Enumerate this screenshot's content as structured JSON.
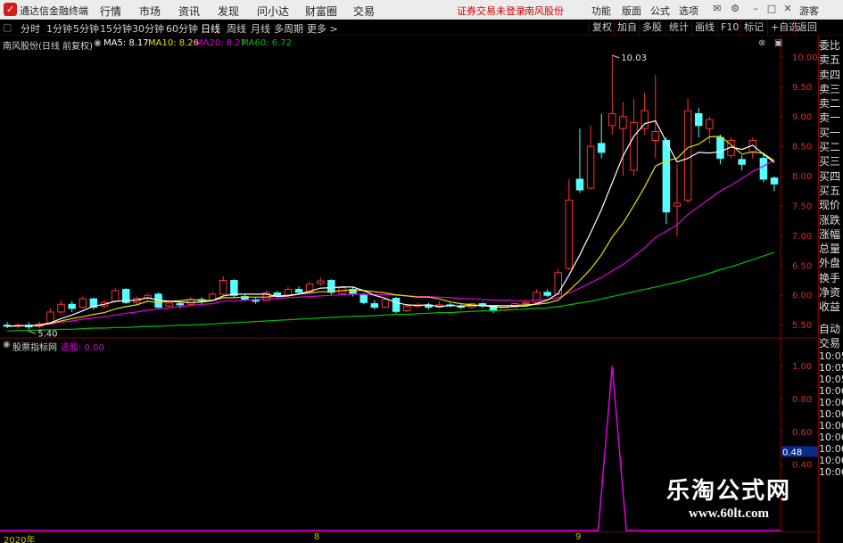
{
  "titlebar": {
    "app_name": "通达信金融终端",
    "menus": [
      "行情",
      "市场",
      "资讯",
      "发现",
      "问小达",
      "财富圈",
      "交易"
    ],
    "notice": "证券交易未登录",
    "stock_name": "南风股份",
    "right_menus": [
      "功能",
      "版面",
      "公式",
      "选项"
    ],
    "account": "游客"
  },
  "toolbar": {
    "periods": [
      "分时",
      "1分钟",
      "5分钟",
      "15分钟",
      "30分钟",
      "60分钟",
      "日线",
      "周线",
      "月线",
      "多周期",
      "更多 >"
    ],
    "active_period": "日线",
    "right_buttons": [
      "复权",
      "加自",
      "多股",
      "统计",
      "画线",
      "F10",
      "标记",
      "+自选",
      "返回"
    ]
  },
  "main_chart": {
    "title": "南风股份(日线 前复权)",
    "ma_legend": [
      {
        "label": "MA5: 8.17",
        "color": "#ffffff"
      },
      {
        "label": "MA10: 8.26",
        "color": "#e8e000"
      },
      {
        "label": "MA20: 8.27",
        "color": "#e000e0"
      },
      {
        "label": "MA60: 6.72",
        "color": "#00c000"
      }
    ],
    "y_ticks": [
      "10.00",
      "9.50",
      "9.00",
      "8.50",
      "8.00",
      "7.50",
      "7.00",
      "6.50",
      "6.00",
      "5.50"
    ],
    "high_label": "10.03",
    "low_label": "5.40",
    "up_color": "#ff3232",
    "down_color": "#54ffff"
  },
  "sub_chart": {
    "title": "股票指标网",
    "legend_label": "选股: 0.00",
    "legend_color": "#e000e0",
    "y_ticks": [
      "1.00",
      "0.80",
      "0.60",
      "0.40"
    ],
    "current_value": "0.48"
  },
  "right_panel": {
    "items": [
      "委比",
      "卖五",
      "卖四",
      "卖三",
      "卖二",
      "卖一",
      "买一",
      "买二",
      "买三",
      "买四",
      "买五",
      "现价",
      "涨跌",
      "涨幅",
      "总量",
      "外盘",
      "换手",
      "净资",
      "收益"
    ],
    "sub_items": [
      "自动",
      "交易"
    ],
    "times": [
      "10:05",
      "10:05",
      "10:05",
      "10:06",
      "10:06",
      "10:06",
      "10:06",
      "10:06",
      "10:06",
      "10:06",
      "10:06"
    ]
  },
  "bottom_axis": {
    "labels": [
      "2020年",
      "8",
      "9"
    ]
  },
  "watermark": {
    "line1": "乐淘公式网",
    "line2": "www.60lt.com"
  },
  "chart_data": {
    "type": "candlestick",
    "title": "南风股份(日线 前复权)",
    "ylim": [
      5.3,
      10.15
    ],
    "candles": [
      {
        "o": 5.5,
        "c": 5.48,
        "h": 5.55,
        "l": 5.45
      },
      {
        "o": 5.48,
        "c": 5.5,
        "h": 5.53,
        "l": 5.44
      },
      {
        "o": 5.5,
        "c": 5.47,
        "h": 5.55,
        "l": 5.4
      },
      {
        "o": 5.48,
        "c": 5.52,
        "h": 5.56,
        "l": 5.45
      },
      {
        "o": 5.52,
        "c": 5.72,
        "h": 5.78,
        "l": 5.5
      },
      {
        "o": 5.72,
        "c": 5.85,
        "h": 5.92,
        "l": 5.7
      },
      {
        "o": 5.85,
        "c": 5.78,
        "h": 5.9,
        "l": 5.72
      },
      {
        "o": 5.8,
        "c": 5.94,
        "h": 5.98,
        "l": 5.78
      },
      {
        "o": 5.94,
        "c": 5.8,
        "h": 5.96,
        "l": 5.76
      },
      {
        "o": 5.82,
        "c": 5.88,
        "h": 5.92,
        "l": 5.78
      },
      {
        "o": 5.9,
        "c": 6.08,
        "h": 6.12,
        "l": 5.88
      },
      {
        "o": 6.1,
        "c": 5.88,
        "h": 6.12,
        "l": 5.85
      },
      {
        "o": 5.88,
        "c": 5.95,
        "h": 5.98,
        "l": 5.85
      },
      {
        "o": 5.95,
        "c": 6.0,
        "h": 6.03,
        "l": 5.92
      },
      {
        "o": 6.02,
        "c": 5.8,
        "h": 6.05,
        "l": 5.78
      },
      {
        "o": 5.82,
        "c": 5.87,
        "h": 5.92,
        "l": 5.8
      },
      {
        "o": 5.86,
        "c": 5.84,
        "h": 5.9,
        "l": 5.78
      },
      {
        "o": 5.85,
        "c": 5.93,
        "h": 5.97,
        "l": 5.82
      },
      {
        "o": 5.93,
        "c": 5.91,
        "h": 5.97,
        "l": 5.86
      },
      {
        "o": 5.92,
        "c": 6.02,
        "h": 6.06,
        "l": 5.9
      },
      {
        "o": 6.02,
        "c": 6.25,
        "h": 6.32,
        "l": 6.0
      },
      {
        "o": 6.25,
        "c": 6.0,
        "h": 6.27,
        "l": 5.95
      },
      {
        "o": 5.98,
        "c": 5.93,
        "h": 6.02,
        "l": 5.9
      },
      {
        "o": 5.92,
        "c": 5.9,
        "h": 5.96,
        "l": 5.86
      },
      {
        "o": 5.91,
        "c": 6.04,
        "h": 6.08,
        "l": 5.89
      },
      {
        "o": 6.04,
        "c": 6.0,
        "h": 6.08,
        "l": 5.97
      },
      {
        "o": 6.0,
        "c": 6.1,
        "h": 6.14,
        "l": 5.98
      },
      {
        "o": 6.1,
        "c": 6.05,
        "h": 6.15,
        "l": 6.02
      },
      {
        "o": 6.06,
        "c": 6.19,
        "h": 6.22,
        "l": 6.04
      },
      {
        "o": 6.2,
        "c": 6.24,
        "h": 6.3,
        "l": 6.16
      },
      {
        "o": 6.25,
        "c": 6.05,
        "h": 6.27,
        "l": 6.0
      },
      {
        "o": 6.03,
        "c": 6.13,
        "h": 6.16,
        "l": 6.0
      },
      {
        "o": 6.1,
        "c": 6.02,
        "h": 6.14,
        "l": 5.98
      },
      {
        "o": 6.0,
        "c": 5.88,
        "h": 6.04,
        "l": 5.85
      },
      {
        "o": 5.86,
        "c": 5.8,
        "h": 5.92,
        "l": 5.76
      },
      {
        "o": 5.8,
        "c": 5.93,
        "h": 5.96,
        "l": 5.78
      },
      {
        "o": 5.95,
        "c": 5.73,
        "h": 5.97,
        "l": 5.7
      },
      {
        "o": 5.74,
        "c": 5.82,
        "h": 5.85,
        "l": 5.72
      },
      {
        "o": 5.82,
        "c": 5.84,
        "h": 5.88,
        "l": 5.78
      },
      {
        "o": 5.84,
        "c": 5.8,
        "h": 5.88,
        "l": 5.76
      },
      {
        "o": 5.8,
        "c": 5.84,
        "h": 5.9,
        "l": 5.78
      },
      {
        "o": 5.84,
        "c": 5.83,
        "h": 5.87,
        "l": 5.8
      },
      {
        "o": 5.82,
        "c": 5.8,
        "h": 5.85,
        "l": 5.77
      },
      {
        "o": 5.8,
        "c": 5.86,
        "h": 5.88,
        "l": 5.78
      },
      {
        "o": 5.86,
        "c": 5.82,
        "h": 5.88,
        "l": 5.79
      },
      {
        "o": 5.82,
        "c": 5.74,
        "h": 5.84,
        "l": 5.7
      },
      {
        "o": 5.75,
        "c": 5.8,
        "h": 5.83,
        "l": 5.73
      },
      {
        "o": 5.8,
        "c": 5.86,
        "h": 5.88,
        "l": 5.78
      },
      {
        "o": 5.86,
        "c": 5.88,
        "h": 5.92,
        "l": 5.84
      },
      {
        "o": 5.88,
        "c": 6.05,
        "h": 6.1,
        "l": 5.86
      },
      {
        "o": 6.05,
        "c": 6.0,
        "h": 6.1,
        "l": 5.97
      },
      {
        "o": 6.02,
        "c": 6.38,
        "h": 6.45,
        "l": 6.0
      },
      {
        "o": 6.45,
        "c": 7.6,
        "h": 7.95,
        "l": 6.42
      },
      {
        "o": 7.95,
        "c": 7.77,
        "h": 8.8,
        "l": 7.72
      },
      {
        "o": 7.8,
        "c": 8.5,
        "h": 8.85,
        "l": 7.78
      },
      {
        "o": 8.55,
        "c": 8.4,
        "h": 9.05,
        "l": 8.3
      },
      {
        "o": 8.85,
        "c": 9.05,
        "h": 10.03,
        "l": 8.7
      },
      {
        "o": 8.8,
        "c": 9.0,
        "h": 9.25,
        "l": 8.0
      },
      {
        "o": 8.1,
        "c": 8.9,
        "h": 9.3,
        "l": 8.0
      },
      {
        "o": 8.8,
        "c": 9.1,
        "h": 9.4,
        "l": 8.7
      },
      {
        "o": 8.6,
        "c": 8.75,
        "h": 9.7,
        "l": 8.3
      },
      {
        "o": 8.6,
        "c": 7.4,
        "h": 8.65,
        "l": 7.2
      },
      {
        "o": 7.5,
        "c": 7.55,
        "h": 8.2,
        "l": 7.0
      },
      {
        "o": 7.6,
        "c": 9.1,
        "h": 9.3,
        "l": 7.55
      },
      {
        "o": 9.05,
        "c": 8.85,
        "h": 9.15,
        "l": 8.65
      },
      {
        "o": 8.8,
        "c": 8.95,
        "h": 9.0,
        "l": 8.55
      },
      {
        "o": 8.65,
        "c": 8.3,
        "h": 8.7,
        "l": 8.2
      },
      {
        "o": 8.35,
        "c": 8.6,
        "h": 8.65,
        "l": 8.3
      },
      {
        "o": 8.28,
        "c": 8.2,
        "h": 8.35,
        "l": 8.1
      },
      {
        "o": 8.4,
        "c": 8.6,
        "h": 8.65,
        "l": 8.3
      },
      {
        "o": 8.3,
        "c": 7.95,
        "h": 8.4,
        "l": 7.9
      },
      {
        "o": 7.97,
        "c": 7.87,
        "h": 8.0,
        "l": 7.75
      }
    ],
    "ma5": [
      5.48,
      5.49,
      5.49,
      5.5,
      5.54,
      5.61,
      5.67,
      5.74,
      5.82,
      5.85,
      5.9,
      5.91,
      5.92,
      5.96,
      5.92,
      5.9,
      5.89,
      5.88,
      5.89,
      5.91,
      5.99,
      6.02,
      6.02,
      6.02,
      6.02,
      5.98,
      5.99,
      6.02,
      6.07,
      6.12,
      6.13,
      6.14,
      6.14,
      6.08,
      6.0,
      5.95,
      5.88,
      5.84,
      5.83,
      5.84,
      5.81,
      5.83,
      5.82,
      5.83,
      5.83,
      5.81,
      5.8,
      5.82,
      5.82,
      5.86,
      5.92,
      6.03,
      6.34,
      6.68,
      7.05,
      7.44,
      7.89,
      8.34,
      8.67,
      8.88,
      8.93,
      8.58,
      8.24,
      8.3,
      8.4,
      8.39,
      8.41,
      8.49,
      8.45,
      8.52,
      8.37,
      8.23
    ],
    "ma10": [
      5.48,
      5.49,
      5.49,
      5.49,
      5.53,
      5.57,
      5.61,
      5.64,
      5.68,
      5.71,
      5.77,
      5.81,
      5.84,
      5.9,
      5.88,
      5.9,
      5.91,
      5.93,
      5.92,
      5.91,
      5.96,
      5.96,
      5.97,
      5.97,
      5.97,
      5.99,
      6.0,
      6.02,
      6.04,
      6.06,
      6.06,
      6.08,
      6.09,
      6.08,
      6.06,
      6.04,
      6.01,
      5.99,
      5.97,
      5.97,
      5.94,
      5.89,
      5.86,
      5.84,
      5.83,
      5.83,
      5.83,
      5.83,
      5.84,
      5.85,
      5.87,
      5.92,
      6.08,
      6.25,
      6.44,
      6.68,
      6.98,
      7.21,
      7.51,
      7.82,
      8.17,
      8.26,
      8.3,
      8.48,
      8.54,
      8.66,
      8.67,
      8.53,
      8.37,
      8.41,
      8.38,
      8.26
    ],
    "ma20": [
      5.48,
      5.49,
      5.49,
      5.49,
      5.52,
      5.55,
      5.57,
      5.6,
      5.62,
      5.64,
      5.67,
      5.7,
      5.72,
      5.75,
      5.77,
      5.79,
      5.81,
      5.83,
      5.85,
      5.86,
      5.9,
      5.91,
      5.92,
      5.93,
      5.94,
      5.95,
      5.96,
      5.97,
      5.98,
      5.99,
      6.0,
      6.01,
      6.02,
      6.02,
      6.01,
      6.01,
      6.0,
      5.99,
      5.98,
      5.98,
      5.97,
      5.96,
      5.95,
      5.94,
      5.93,
      5.92,
      5.92,
      5.91,
      5.91,
      5.92,
      5.93,
      5.96,
      6.04,
      6.12,
      6.21,
      6.3,
      6.41,
      6.52,
      6.65,
      6.8,
      6.97,
      7.08,
      7.18,
      7.36,
      7.49,
      7.62,
      7.75,
      7.85,
      7.96,
      8.08,
      8.17,
      8.27
    ],
    "ma60": [
      5.4,
      5.41,
      5.41,
      5.42,
      5.42,
      5.43,
      5.43,
      5.44,
      5.45,
      5.45,
      5.46,
      5.46,
      5.47,
      5.48,
      5.48,
      5.49,
      5.5,
      5.5,
      5.51,
      5.52,
      5.53,
      5.54,
      5.55,
      5.56,
      5.57,
      5.58,
      5.59,
      5.6,
      5.61,
      5.62,
      5.63,
      5.64,
      5.65,
      5.65,
      5.66,
      5.67,
      5.68,
      5.68,
      5.69,
      5.7,
      5.71,
      5.71,
      5.72,
      5.73,
      5.74,
      5.74,
      5.75,
      5.76,
      5.77,
      5.78,
      5.79,
      5.81,
      5.84,
      5.87,
      5.9,
      5.94,
      5.98,
      6.02,
      6.06,
      6.1,
      6.14,
      6.18,
      6.22,
      6.27,
      6.32,
      6.37,
      6.43,
      6.48,
      6.54,
      6.6,
      6.66,
      6.72
    ],
    "sub_series": {
      "name": "选股",
      "ylim": [
        0,
        1.1
      ],
      "signal_index": 56,
      "values_note_none": ""
    }
  }
}
